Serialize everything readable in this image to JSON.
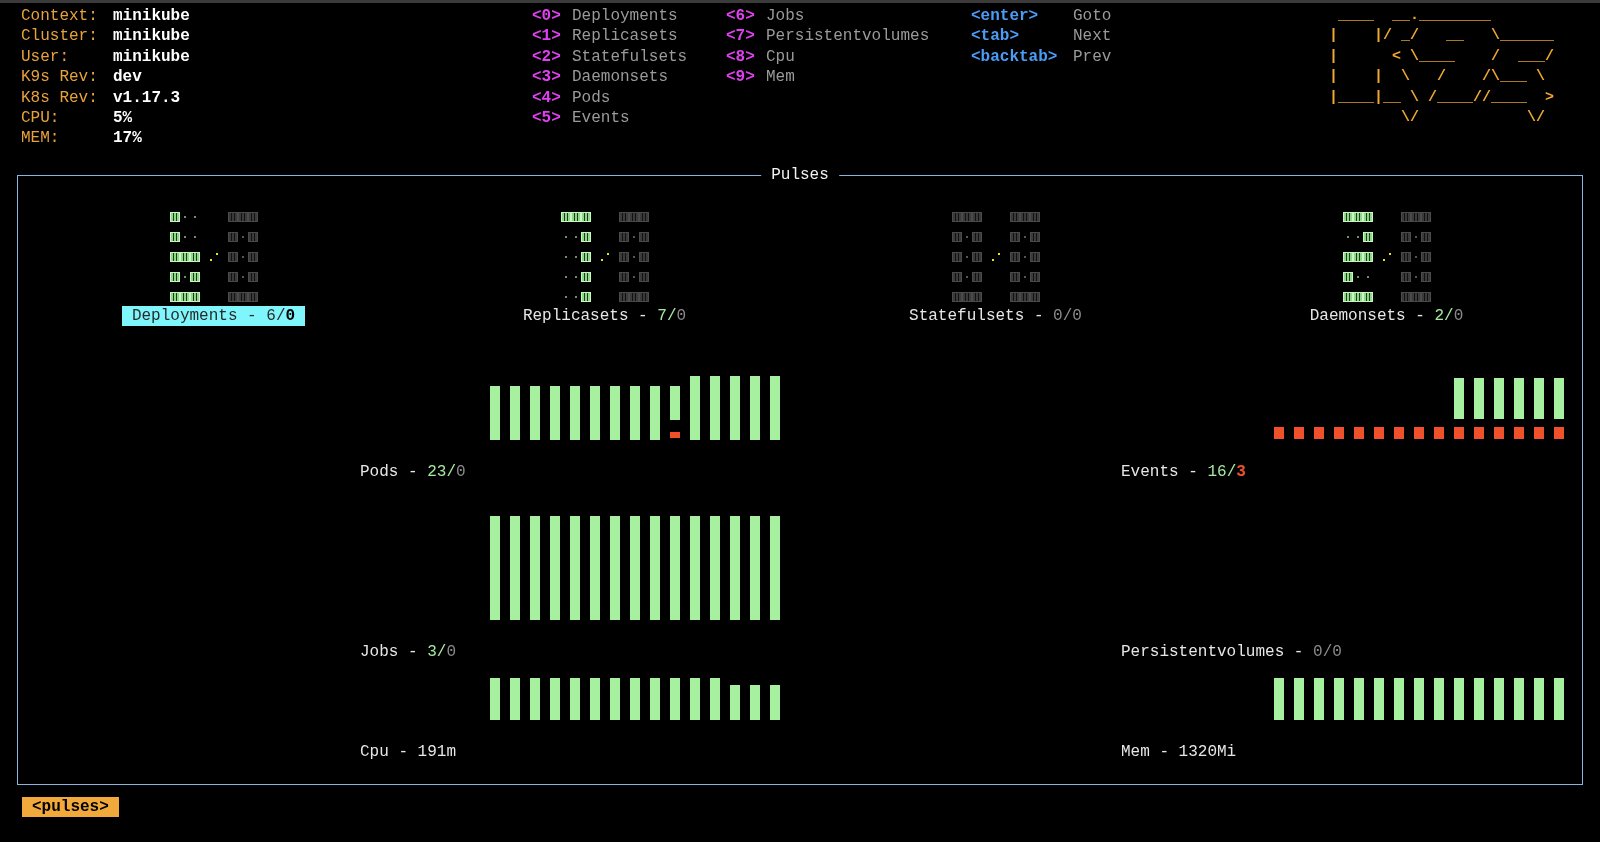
{
  "cluster_info": [
    {
      "label": "Context:",
      "value": "minikube"
    },
    {
      "label": "Cluster:",
      "value": "minikube"
    },
    {
      "label": "User:",
      "value": "minikube"
    },
    {
      "label": "K9s Rev:",
      "value": "dev"
    },
    {
      "label": "K8s Rev:",
      "value": "v1.17.3"
    },
    {
      "label": "CPU:",
      "value": "5%"
    },
    {
      "label": "MEM:",
      "value": "17%"
    }
  ],
  "view_hotkeys": [
    [
      {
        "key": "<0>",
        "action": "Deployments"
      },
      {
        "key": "<1>",
        "action": "Replicasets"
      },
      {
        "key": "<2>",
        "action": "Statefulsets"
      },
      {
        "key": "<3>",
        "action": "Daemonsets"
      },
      {
        "key": "<4>",
        "action": "Pods"
      },
      {
        "key": "<5>",
        "action": "Events"
      }
    ],
    [
      {
        "key": "<6>",
        "action": "Jobs"
      },
      {
        "key": "<7>",
        "action": "Persistentvolumes"
      },
      {
        "key": "<8>",
        "action": "Cpu"
      },
      {
        "key": "<9>",
        "action": "Mem"
      }
    ]
  ],
  "nav_hotkeys": [
    {
      "key": "<enter>",
      "action": "Goto"
    },
    {
      "key": "<tab>",
      "action": "Next"
    },
    {
      "key": "<backtab>",
      "action": "Prev"
    }
  ],
  "logo": [
    " ____  __.________       ",
    "|    |/ _/   __   \\______",
    "|      < \\____    /  ___/",
    "|    |  \\   /    /\\___ \\ ",
    "|____|__ \\ /____//____  >",
    "        \\/            \\/ "
  ],
  "panel": {
    "title": "Pulses",
    "gauges": [
      {
        "name": "Deployments - ",
        "ok": "6",
        "separator": "/",
        "fault": "0",
        "active": true,
        "failing": false,
        "selected": true
      },
      {
        "name": "Replicasets - ",
        "ok": "7",
        "separator": "/",
        "fault": "0",
        "active": true,
        "failing": false,
        "selected": false
      },
      {
        "name": "Statefulsets - ",
        "ok": "0",
        "separator": "/",
        "fault": "0",
        "active": false,
        "failing": false,
        "selected": false
      },
      {
        "name": "Daemonsets - ",
        "ok": "2",
        "separator": "/",
        "fault": "0",
        "active": true,
        "failing": false,
        "selected": false
      }
    ],
    "pulses": [
      {
        "kind": "pods",
        "name": "Pods - ",
        "ok": "23",
        "separator": "/",
        "fault": "0",
        "active": true,
        "failing": false
      },
      {
        "kind": "events",
        "name": "Events - ",
        "ok": "16",
        "separator": "/",
        "fault": "3",
        "active": true,
        "failing": true
      },
      {
        "kind": "jobs",
        "name": "Jobs - ",
        "ok": "3",
        "separator": "/",
        "fault": "0",
        "active": true,
        "failing": false
      },
      {
        "kind": "empty",
        "name": "Persistentvolumes - ",
        "ok": "0",
        "separator": "/",
        "fault": "0",
        "active": false,
        "failing": false
      },
      {
        "kind": "cpu",
        "name": "Cpu - ",
        "value": "191m"
      },
      {
        "kind": "mem",
        "name": "Mem - ",
        "value": "1320Mi"
      }
    ]
  },
  "footer": {
    "crumb": "<pulses>"
  }
}
